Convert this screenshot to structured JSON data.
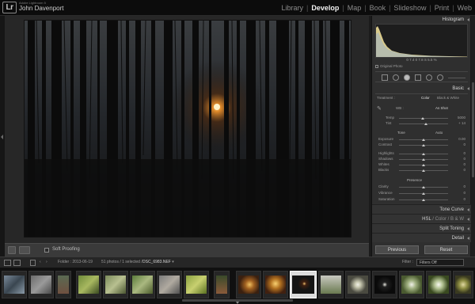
{
  "app": {
    "logo_text": "Lr",
    "product_name": "Adobe Lightroom 5",
    "user_name": "John Davenport"
  },
  "modules": [
    {
      "label": "Library",
      "active": false
    },
    {
      "label": "Develop",
      "active": true
    },
    {
      "label": "Map",
      "active": false
    },
    {
      "label": "Book",
      "active": false
    },
    {
      "label": "Slideshow",
      "active": false
    },
    {
      "label": "Print",
      "active": false
    },
    {
      "label": "Web",
      "active": false
    }
  ],
  "toolbar": {
    "soft_proofing_label": "Soft Proofing"
  },
  "panel": {
    "histogram": {
      "title": "Histogram",
      "readout": "0   7.4   0   7.8   S   5.5  %",
      "original_photo_label": "Original Photo"
    },
    "basic": {
      "title": "Basic",
      "treatment_label": "Treatment :",
      "treatment_color": "Color",
      "treatment_bw": "Black & White",
      "wb_label": "WB :",
      "wb_value": "As Shot",
      "temp_label": "Temp",
      "temp_value": "5000",
      "tint_label": "Tint",
      "tint_value": "+ 14",
      "tone_label": "Tone",
      "auto_label": "Auto",
      "exposure_label": "Exposure",
      "exposure_value": "0.00",
      "contrast_label": "Contrast",
      "contrast_value": "0",
      "highlights_label": "Highlights",
      "highlights_value": "0",
      "shadows_label": "Shadows",
      "shadows_value": "0",
      "whites_label": "Whites",
      "whites_value": "0",
      "blacks_label": "Blacks",
      "blacks_value": "0",
      "presence_label": "Presence",
      "clarity_label": "Clarity",
      "clarity_value": "0",
      "vibrance_label": "Vibrance",
      "vibrance_value": "0",
      "saturation_label": "Saturation",
      "saturation_value": "0"
    },
    "collapsed_panels": {
      "tone_curve": "Tone Curve",
      "hsl": "HSL",
      "color": "Color",
      "bw": "B & W",
      "split_toning": "Split Toning",
      "detail": "Detail"
    },
    "previous_button": "Previous",
    "reset_button": "Reset"
  },
  "filmstrip_bar": {
    "folder_text": "Folder : 2013-06-19",
    "count_text": "51 photos / 1 selected /",
    "filename": "DSC_6983.NEF",
    "filter_label": "Filter :",
    "filter_value": "Filters Off"
  },
  "colors": {
    "background": "#1b1b1b",
    "panel": "#2f2f2f",
    "histogram_fill": "#d8c98a",
    "active_module": "#f2f2f2"
  }
}
